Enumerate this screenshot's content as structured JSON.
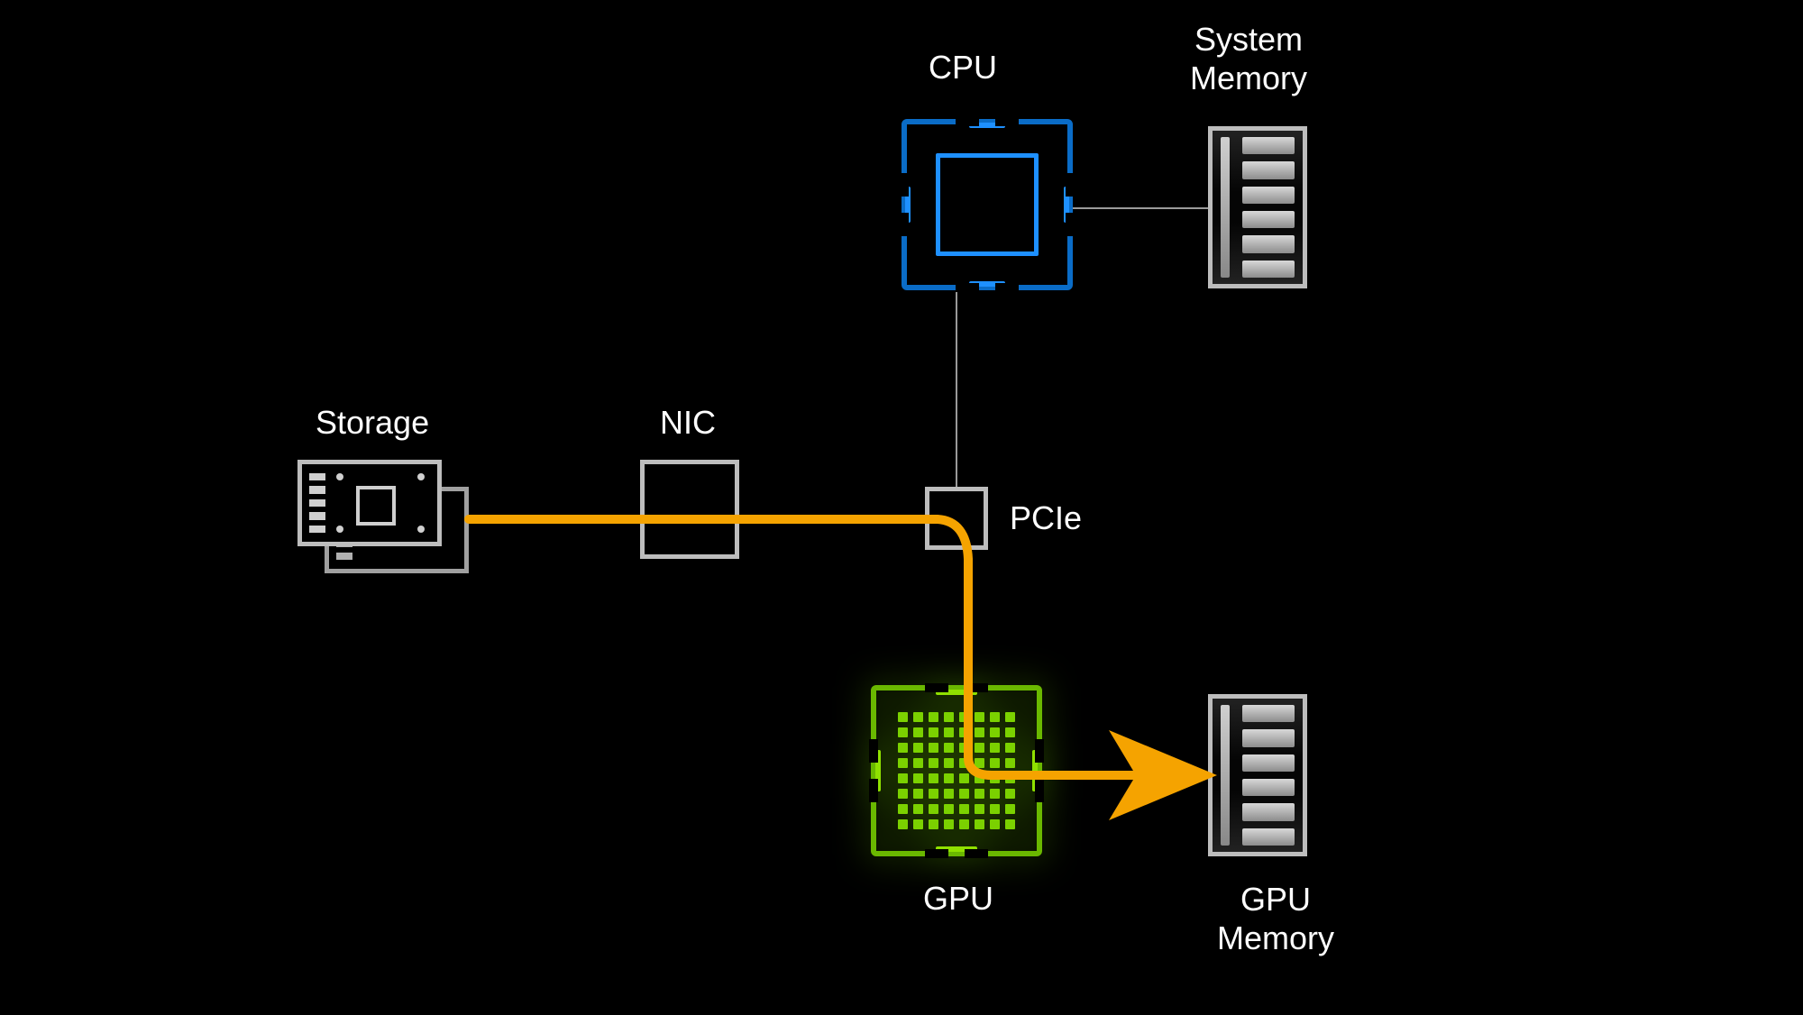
{
  "labels": {
    "cpu": "CPU",
    "system_memory": "System\nMemory",
    "storage": "Storage",
    "nic": "NIC",
    "pcie": "PCIe",
    "gpu": "GPU",
    "gpu_memory": "GPU\nMemory"
  },
  "colors": {
    "cpu_border": "#0a6cc7",
    "cpu_inner": "#1e90ff",
    "gpu": "#7bd100",
    "gpu_border": "#6ab800",
    "flow": "#f5a300",
    "line": "#9a9a9a",
    "frame": "#bdbdbd"
  },
  "nodes": [
    {
      "id": "storage",
      "label": "Storage"
    },
    {
      "id": "nic",
      "label": "NIC"
    },
    {
      "id": "pcie",
      "label": "PCIe"
    },
    {
      "id": "cpu",
      "label": "CPU"
    },
    {
      "id": "system_memory",
      "label": "System Memory"
    },
    {
      "id": "gpu",
      "label": "GPU"
    },
    {
      "id": "gpu_memory",
      "label": "GPU Memory"
    }
  ],
  "connections": [
    {
      "from": "cpu",
      "to": "system_memory",
      "type": "bus"
    },
    {
      "from": "cpu",
      "to": "pcie",
      "type": "bus"
    },
    {
      "from": "storage",
      "to": "nic",
      "type": "flow"
    },
    {
      "from": "nic",
      "to": "pcie",
      "type": "flow"
    },
    {
      "from": "pcie",
      "to": "gpu",
      "type": "flow"
    },
    {
      "from": "gpu",
      "to": "gpu_memory",
      "type": "flow_arrow"
    }
  ],
  "flow_description": "Data path from Storage through NIC and PCIe into GPU and then to GPU Memory, bypassing CPU and System Memory."
}
